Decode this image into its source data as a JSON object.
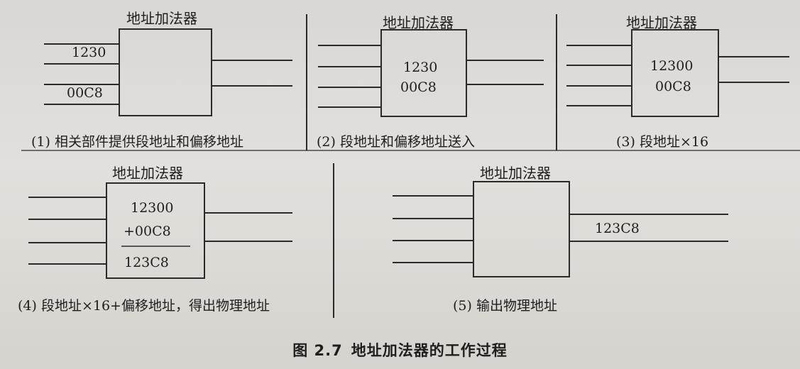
{
  "panels": [
    {
      "title": "地址加法器",
      "caption": "(1) 相关部件提供段地址和偏移地址",
      "inputs": [
        "1230",
        "00C8"
      ]
    },
    {
      "title": "地址加法器",
      "caption": "(2) 段地址和偏移地址送入",
      "contents": [
        "1230",
        "00C8"
      ]
    },
    {
      "title": "地址加法器",
      "caption": "(3) 段地址×16",
      "contents": [
        "12300",
        "00C8"
      ]
    },
    {
      "title": "地址加法器",
      "caption": "(4) 段地址×16+偏移地址，得出物理地址",
      "contents": [
        "12300",
        "+00C8",
        "123C8"
      ]
    },
    {
      "title": "地址加法器",
      "caption": "(5) 输出物理地址",
      "output": "123C8"
    }
  ],
  "figure": {
    "number": "图 2.7",
    "title": "地址加法器的工作过程"
  },
  "colors": {
    "ink": "#2a2a2a",
    "paper": "#dcd9d6"
  }
}
